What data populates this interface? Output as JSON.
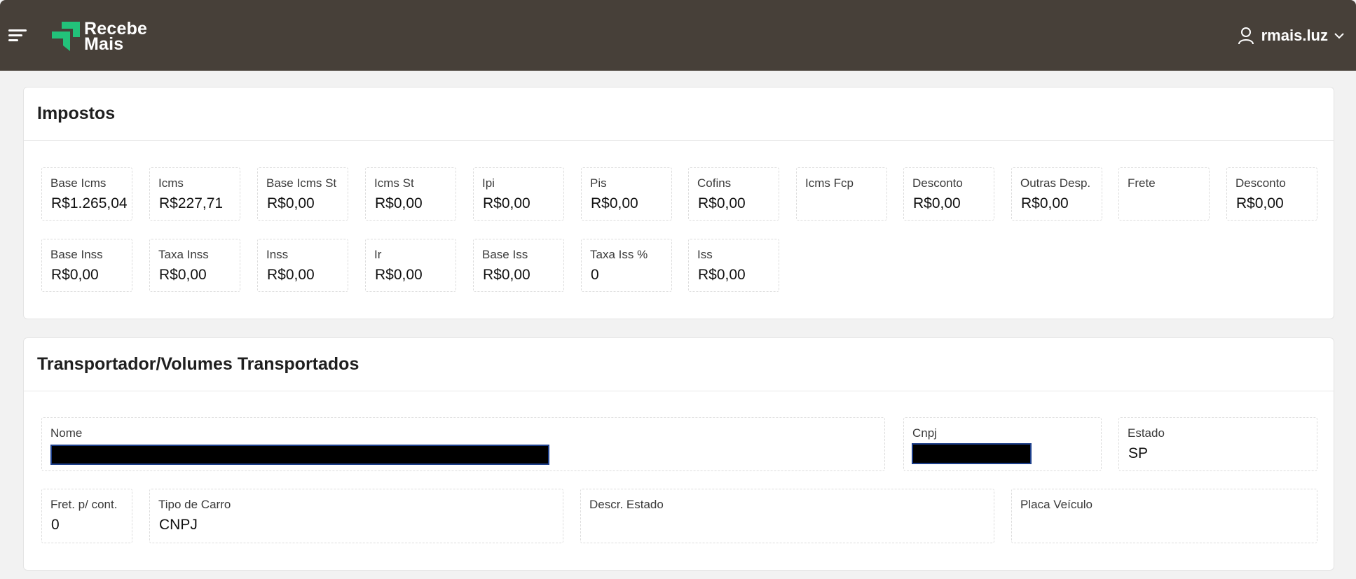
{
  "header": {
    "brand_line1": "Recebe",
    "brand_line2": "Mais",
    "user_name": "rmais.luz",
    "icons": [
      "menu-icon",
      "user-icon",
      "chevron-down-icon"
    ],
    "bg_color": "#474039",
    "brand_accent": "#22c27a"
  },
  "impostos": {
    "title": "Impostos",
    "row1": [
      {
        "label": "Base Icms",
        "value": "R$1.265,04"
      },
      {
        "label": "Icms",
        "value": "R$227,71"
      },
      {
        "label": "Base Icms St",
        "value": "R$0,00"
      },
      {
        "label": "Icms St",
        "value": "R$0,00"
      },
      {
        "label": "Ipi",
        "value": "R$0,00"
      },
      {
        "label": "Pis",
        "value": "R$0,00"
      },
      {
        "label": "Cofins",
        "value": "R$0,00"
      },
      {
        "label": "Icms Fcp",
        "value": ""
      },
      {
        "label": "Desconto",
        "value": "R$0,00"
      },
      {
        "label": "Outras Desp.",
        "value": "R$0,00"
      },
      {
        "label": "Frete",
        "value": ""
      },
      {
        "label": "Desconto",
        "value": "R$0,00"
      }
    ],
    "row2": [
      {
        "label": "Base Inss",
        "value": "R$0,00"
      },
      {
        "label": "Taxa Inss",
        "value": "R$0,00"
      },
      {
        "label": "Inss",
        "value": "R$0,00"
      },
      {
        "label": "Ir",
        "value": "R$0,00"
      },
      {
        "label": "Base Iss",
        "value": "R$0,00"
      },
      {
        "label": "Taxa Iss %",
        "value": "0"
      },
      {
        "label": "Iss",
        "value": "R$0,00"
      }
    ]
  },
  "transportador": {
    "title": "Transportador/Volumes Transportados",
    "nome": {
      "label": "Nome",
      "value": ""
    },
    "cnpj": {
      "label": "Cnpj",
      "value": ""
    },
    "estado": {
      "label": "Estado",
      "value": "SP"
    },
    "fret": {
      "label": "Fret. p/ cont.",
      "value": "0"
    },
    "tipo_carro": {
      "label": "Tipo de Carro",
      "value": "CNPJ"
    },
    "descr_estado": {
      "label": "Descr. Estado",
      "value": ""
    },
    "placa": {
      "label": "Placa Veículo",
      "value": ""
    }
  }
}
